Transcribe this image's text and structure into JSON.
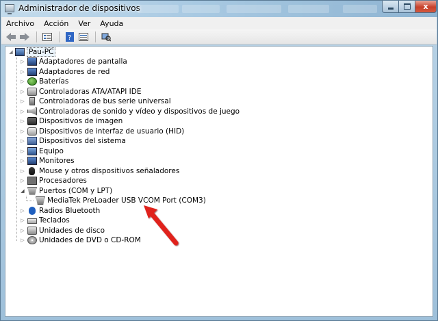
{
  "window": {
    "title": "Administrador de dispositivos",
    "minimize_label": "",
    "maximize_label": "",
    "close_label": "x"
  },
  "menu": {
    "items": [
      "Archivo",
      "Acción",
      "Ver",
      "Ayuda"
    ]
  },
  "toolbar": {
    "buttons": [
      "back-icon",
      "forward-icon",
      "properties-icon",
      "help-icon",
      "view-icon",
      "scan-hardware-icon"
    ]
  },
  "tree": {
    "root": {
      "label": "Pau-PC",
      "expanded": true
    },
    "items": [
      {
        "label": "Adaptadores de pantalla",
        "icon": "display-adapter-icon",
        "expanded": false
      },
      {
        "label": "Adaptadores de red",
        "icon": "network-adapter-icon",
        "expanded": false
      },
      {
        "label": "Baterías",
        "icon": "battery-icon",
        "expanded": false
      },
      {
        "label": "Controladoras ATA/ATAPI IDE",
        "icon": "ide-controller-icon",
        "expanded": false
      },
      {
        "label": "Controladoras de bus serie universal",
        "icon": "usb-controller-icon",
        "expanded": false
      },
      {
        "label": "Controladoras de sonido y vídeo y dispositivos de juego",
        "icon": "sound-icon",
        "expanded": false
      },
      {
        "label": "Dispositivos de imagen",
        "icon": "imaging-device-icon",
        "expanded": false
      },
      {
        "label": "Dispositivos de interfaz de usuario (HID)",
        "icon": "hid-icon",
        "expanded": false
      },
      {
        "label": "Dispositivos del sistema",
        "icon": "system-devices-icon",
        "expanded": false
      },
      {
        "label": "Equipo",
        "icon": "computer-icon",
        "expanded": false
      },
      {
        "label": "Monitores",
        "icon": "monitor-icon",
        "expanded": false
      },
      {
        "label": "Mouse y otros dispositivos señaladores",
        "icon": "mouse-icon",
        "expanded": false
      },
      {
        "label": "Procesadores",
        "icon": "processor-icon",
        "expanded": false
      },
      {
        "label": "Puertos (COM y LPT)",
        "icon": "port-icon",
        "expanded": true
      },
      {
        "label": "MediaTek PreLoader USB VCOM Port (COM3)",
        "icon": "port-icon",
        "child": true
      },
      {
        "label": "Radios Bluetooth",
        "icon": "bluetooth-icon",
        "expanded": false
      },
      {
        "label": "Teclados",
        "icon": "keyboard-icon",
        "expanded": false
      },
      {
        "label": "Unidades de disco",
        "icon": "disk-drive-icon",
        "expanded": false
      },
      {
        "label": "Unidades de DVD o CD-ROM",
        "icon": "dvd-drive-icon",
        "expanded": false
      }
    ]
  },
  "colors": {
    "annotation_arrow": "#e0201c",
    "titlebar": "#a8c9e2",
    "close_button": "#c7402a"
  }
}
